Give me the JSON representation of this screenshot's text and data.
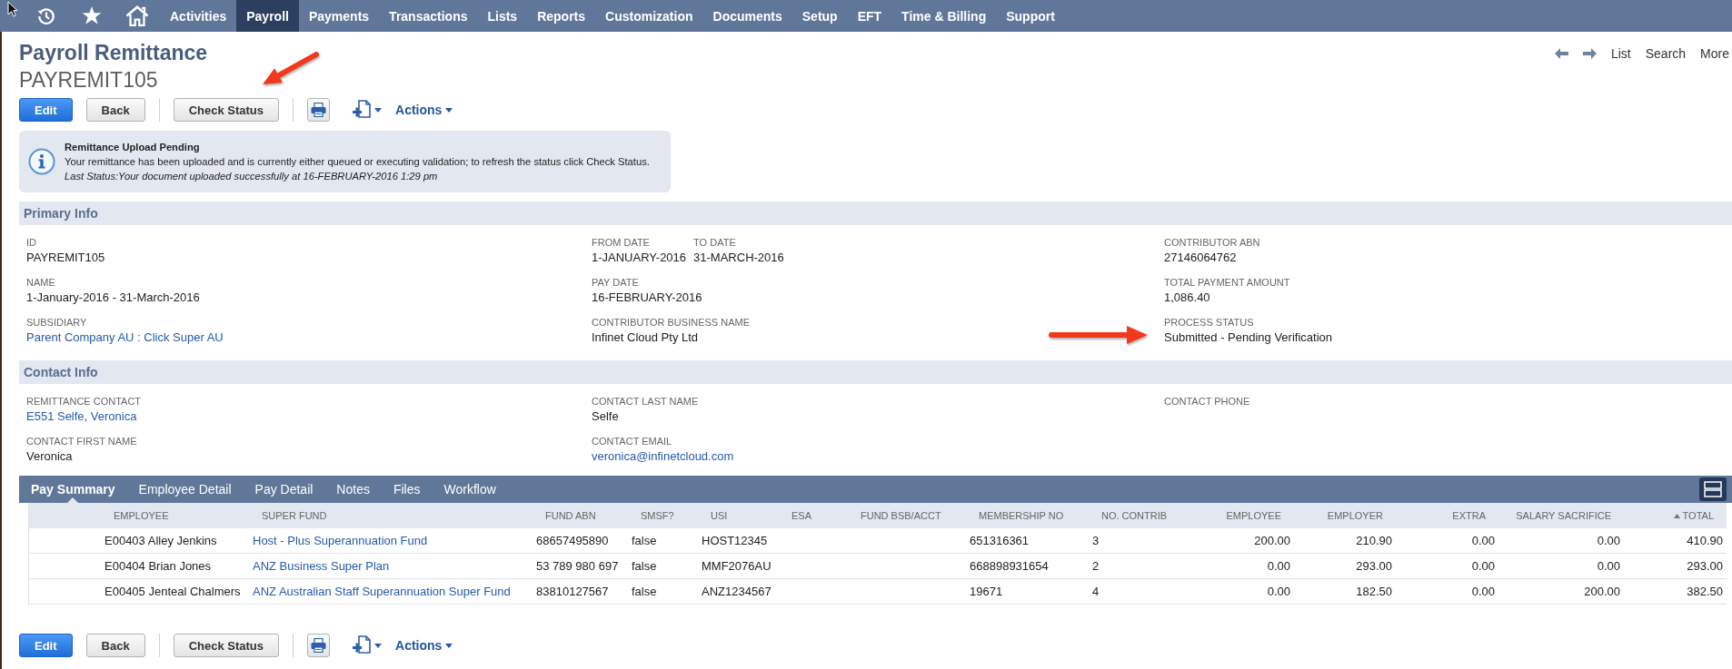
{
  "nav": {
    "items": [
      {
        "label": "Activities",
        "selected": false
      },
      {
        "label": "Payroll",
        "selected": true
      },
      {
        "label": "Payments",
        "selected": false
      },
      {
        "label": "Transactions",
        "selected": false
      },
      {
        "label": "Lists",
        "selected": false
      },
      {
        "label": "Reports",
        "selected": false
      },
      {
        "label": "Customization",
        "selected": false
      },
      {
        "label": "Documents",
        "selected": false
      },
      {
        "label": "Setup",
        "selected": false
      },
      {
        "label": "EFT",
        "selected": false
      },
      {
        "label": "Time & Billing",
        "selected": false
      },
      {
        "label": "Support",
        "selected": false
      }
    ]
  },
  "header": {
    "title": "Payroll Remittance",
    "record_id": "PAYREMIT105",
    "links": [
      "List",
      "Search",
      "More"
    ]
  },
  "toolbar_top": {
    "buttons": [
      {
        "label": "Edit",
        "kind": "primary"
      },
      {
        "label": "Back",
        "kind": "secondary"
      },
      {
        "label": "Check Status",
        "kind": "secondary"
      }
    ],
    "menu": "Actions"
  },
  "notice": {
    "title": "Remittance Upload Pending",
    "message": "Your remittance has been uploaded and is currently either queued or executing validation; to refresh the status click Check Status.",
    "last_status": "Last Status:Your document uploaded successfully at 16-FEBRUARY-2016 1:29 pm"
  },
  "primary_info": {
    "title": "Primary Info",
    "columns": [
      {
        "rows": [
          [
            {
              "label": "ID",
              "value": "PAYREMIT105",
              "link": false
            }
          ],
          [
            {
              "label": "NAME",
              "value": "1-January-2016 - 31-March-2016",
              "link": false
            }
          ],
          [
            {
              "label": "SUBSIDIARY",
              "value": "Parent Company AU : Click Super AU",
              "link": true
            }
          ]
        ]
      },
      {
        "rows": [
          [
            {
              "label": "FROM DATE",
              "value": "1-JANUARY-2016",
              "link": false
            },
            {
              "label": "TO DATE",
              "value": "31-MARCH-2016",
              "link": false
            }
          ],
          [
            {
              "label": "PAY DATE",
              "value": "16-FEBRUARY-2016",
              "link": false
            }
          ],
          [
            {
              "label": "CONTRIBUTOR BUSINESS NAME",
              "value": "Infinet Cloud Pty Ltd",
              "link": false
            }
          ]
        ]
      },
      {
        "rows": [
          [
            {
              "label": "CONTRIBUTOR ABN",
              "value": "27146064762",
              "link": false
            }
          ],
          [
            {
              "label": "TOTAL PAYMENT AMOUNT",
              "value": "1,086.40",
              "link": false
            }
          ],
          [
            {
              "label": "PROCESS STATUS",
              "value": "Submitted - Pending Verification",
              "link": false
            }
          ]
        ]
      }
    ]
  },
  "contact_info": {
    "title": "Contact Info",
    "columns": [
      {
        "rows": [
          [
            {
              "label": "REMITTANCE CONTACT",
              "value": "E551 Selfe, Veronica",
              "link": true
            }
          ],
          [
            {
              "label": "CONTACT FIRST NAME",
              "value": "Veronica",
              "link": false
            }
          ]
        ]
      },
      {
        "rows": [
          [
            {
              "label": "CONTACT LAST NAME",
              "value": "Selfe",
              "link": false
            }
          ],
          [
            {
              "label": "CONTACT EMAIL",
              "value": "veronica@infinetcloud.com",
              "link": true
            }
          ]
        ]
      },
      {
        "rows": [
          [
            {
              "label": "CONTACT PHONE"
            }
          ]
        ]
      }
    ]
  },
  "tabs": [
    {
      "label": "Pay Summary",
      "selected": true
    },
    {
      "label": "Employee Detail",
      "selected": false
    },
    {
      "label": "Pay Detail",
      "selected": false
    },
    {
      "label": "Notes",
      "selected": false
    },
    {
      "label": "Files",
      "selected": false
    },
    {
      "label": "Workflow",
      "selected": false
    }
  ],
  "table": {
    "columns": [
      {
        "label": "EMPLOYEE",
        "kind": "text",
        "sorted": false
      },
      {
        "label": "SUPER FUND",
        "kind": "link",
        "sorted": false
      },
      {
        "label": "FUND ABN",
        "kind": "text",
        "sorted": false
      },
      {
        "label": "SMSF?",
        "kind": "text",
        "sorted": false
      },
      {
        "label": "USI",
        "kind": "text",
        "sorted": false
      },
      {
        "label": "ESA",
        "kind": "text",
        "sorted": false
      },
      {
        "label": "FUND BSB/ACCT",
        "kind": "text",
        "sorted": false
      },
      {
        "label": "MEMBERSHIP NO",
        "kind": "text",
        "sorted": false
      },
      {
        "label": "NO. CONTRIB",
        "kind": "text",
        "sorted": false
      },
      {
        "label": "EMPLOYEE",
        "kind": "amount",
        "sorted": false
      },
      {
        "label": "EMPLOYER",
        "kind": "amount",
        "sorted": false
      },
      {
        "label": "EXTRA",
        "kind": "amount",
        "sorted": false
      },
      {
        "label": "SALARY SACRIFICE",
        "kind": "amount",
        "sorted": false
      },
      {
        "label": "TOTAL",
        "kind": "amount",
        "sorted": true
      }
    ],
    "rows": [
      {
        "cells": [
          "E00403 Alley Jenkins",
          "Host - Plus Superannuation Fund",
          "68657495890",
          "false",
          "HOST12345",
          null,
          null,
          "651316361",
          "3",
          "200.00",
          "210.90",
          "0.00",
          "0.00",
          "410.90"
        ]
      },
      {
        "cells": [
          "E00404 Brian Jones",
          "ANZ Business Super Plan",
          "53 789 980 697",
          "false",
          "MMF2076AU",
          null,
          null,
          "668898931654",
          "2",
          "0.00",
          "293.00",
          "0.00",
          "0.00",
          "293.00"
        ]
      },
      {
        "cells": [
          "E00405 Jenteal Chalmers",
          "ANZ Australian Staff Superannuation Super Fund",
          "83810127567",
          "false",
          "ANZ1234567",
          null,
          null,
          "19671",
          "4",
          "0.00",
          "182.50",
          "0.00",
          "200.00",
          "382.50"
        ]
      }
    ]
  },
  "toolbar_bottom": {
    "buttons": [
      {
        "label": "Edit",
        "kind": "primary"
      },
      {
        "label": "Back",
        "kind": "secondary"
      },
      {
        "label": "Check Status",
        "kind": "secondary"
      }
    ],
    "menu": "Actions"
  }
}
